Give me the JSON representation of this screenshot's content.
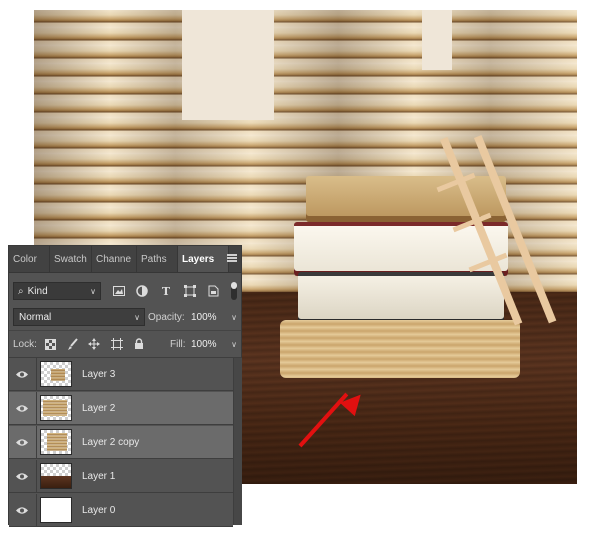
{
  "panel": {
    "tabs": [
      {
        "label": "Color"
      },
      {
        "label": "Swatch"
      },
      {
        "label": "Channe"
      },
      {
        "label": "Paths"
      },
      {
        "label": "Layers",
        "active": true
      }
    ],
    "filter": {
      "kind_label": "Kind",
      "icons": [
        "pixel-filter-icon",
        "adjustment-filter-icon",
        "type-filter-icon",
        "shape-filter-icon",
        "smart-object-filter-icon"
      ]
    },
    "blend_mode": "Normal",
    "opacity_label": "Opacity:",
    "opacity_value": "100%",
    "lock_label": "Lock:",
    "lock_icons": [
      "lock-transparent-icon",
      "lock-paint-icon",
      "lock-position-icon",
      "lock-artboard-icon",
      "lock-all-icon"
    ],
    "fill_label": "Fill:",
    "fill_value": "100%",
    "layers": [
      {
        "name": "Layer 3",
        "visible": true,
        "selected": false
      },
      {
        "name": "Layer 2",
        "visible": true,
        "selected": true
      },
      {
        "name": "Layer 2 copy",
        "visible": true,
        "selected": true
      },
      {
        "name": "Layer 1",
        "visible": true,
        "selected": false
      },
      {
        "name": "Layer 0",
        "visible": true,
        "selected": false
      }
    ]
  },
  "colors": {
    "panel_bg": "#535353",
    "selected_row": "#6b6b6b",
    "arrow": "#e21010"
  }
}
